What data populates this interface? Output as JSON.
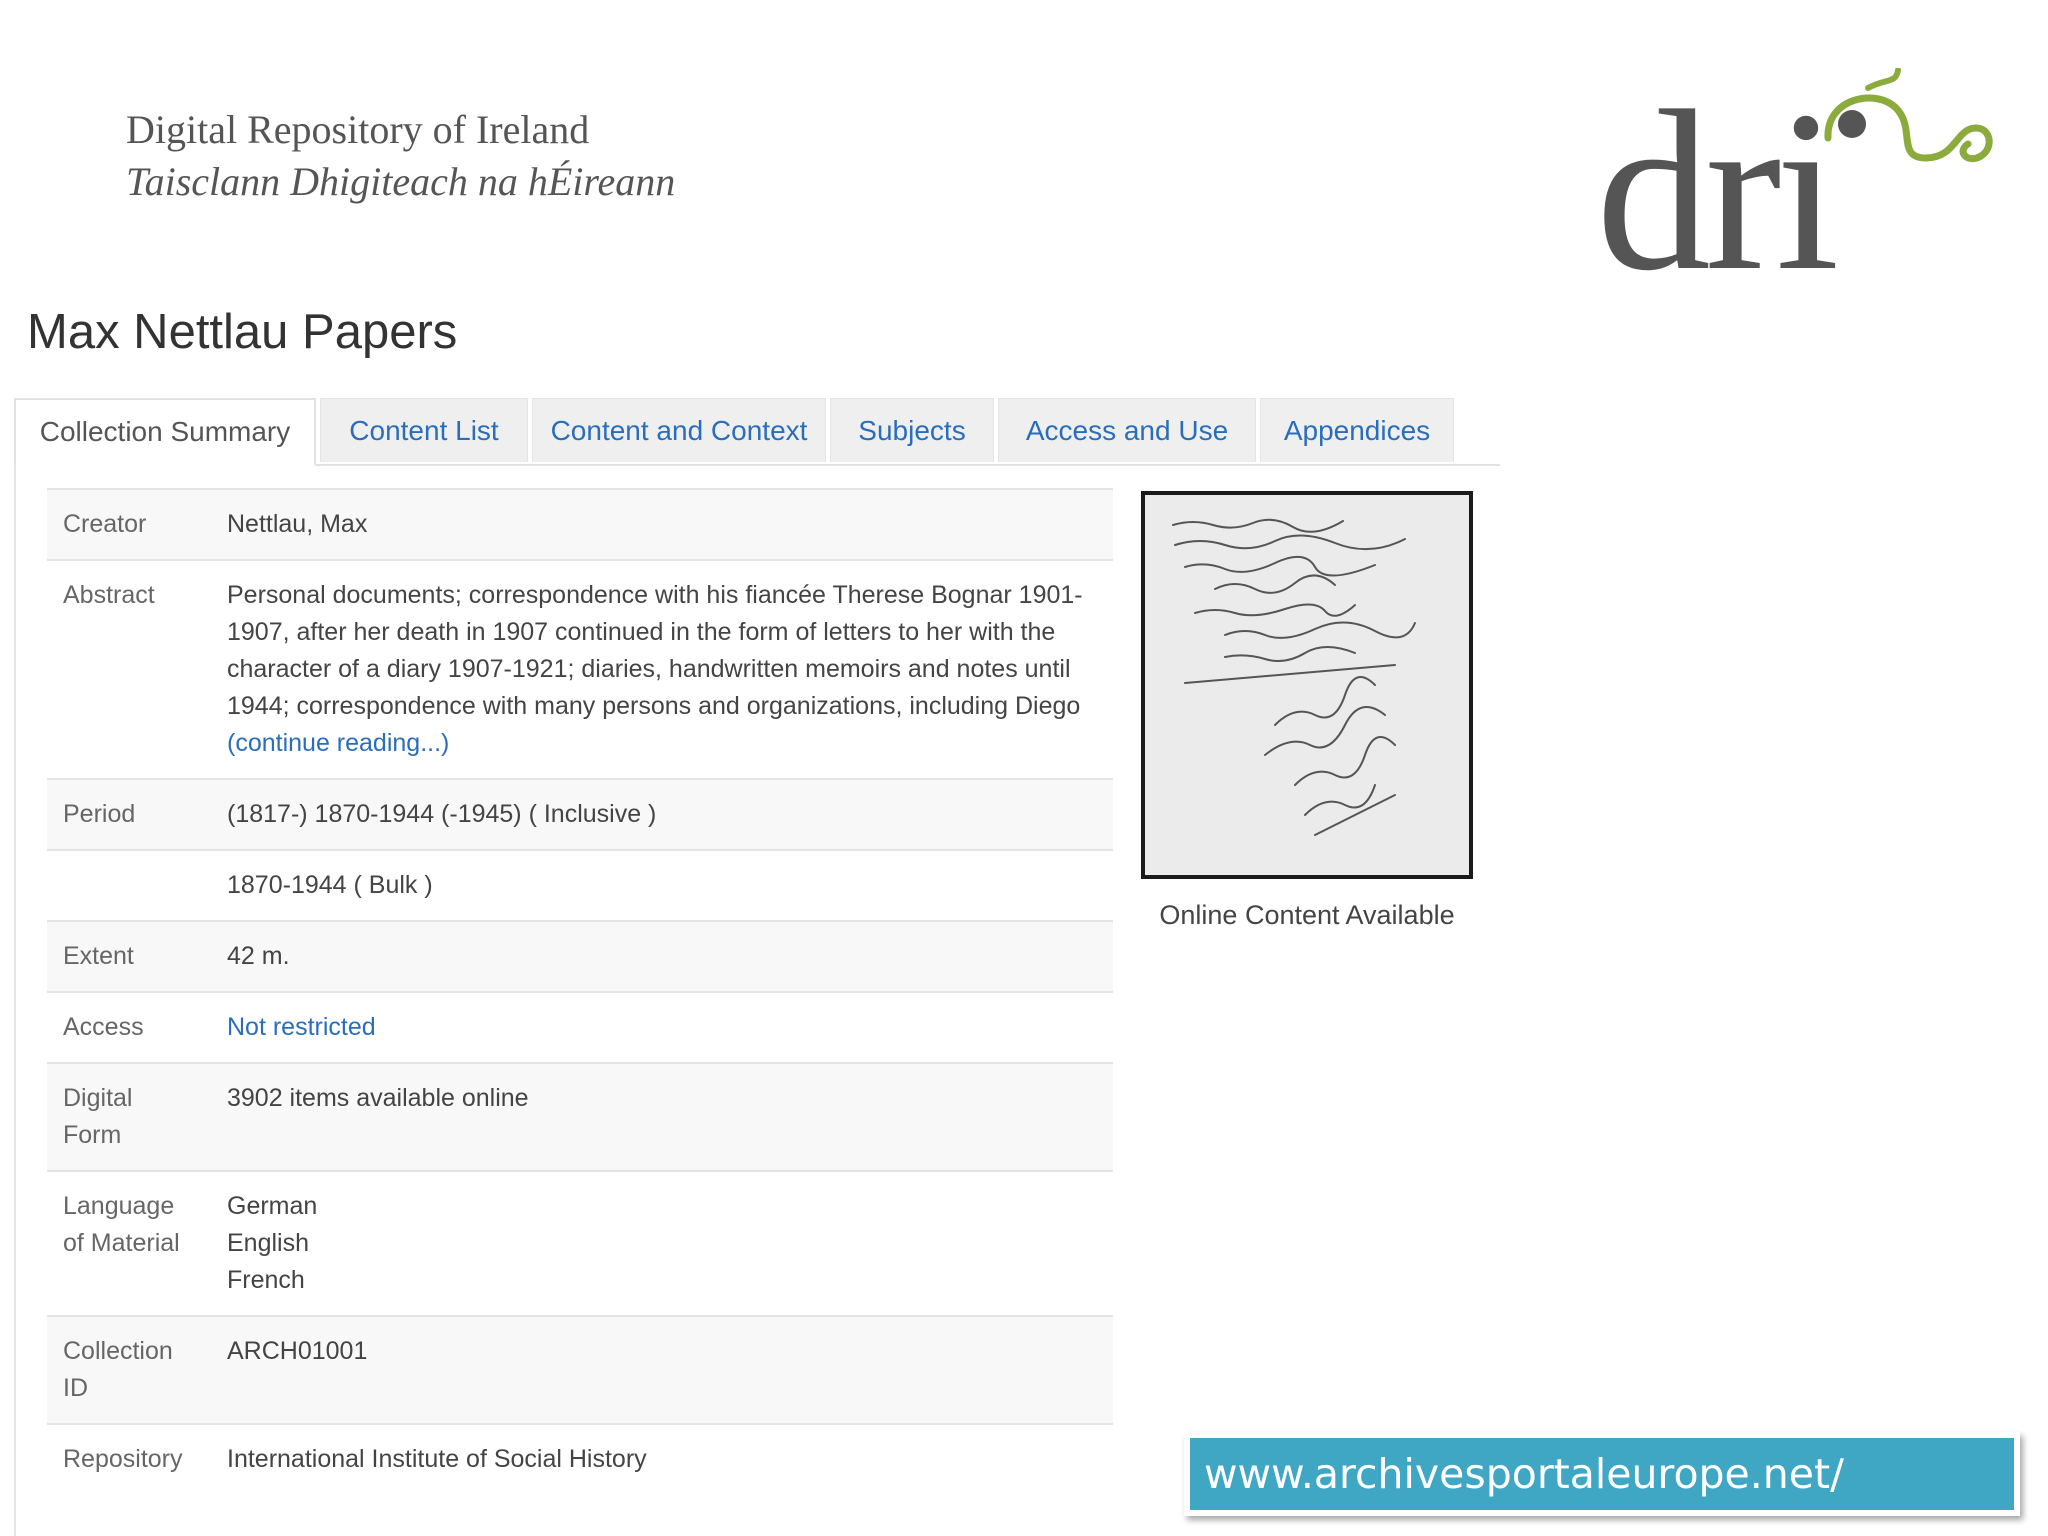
{
  "header": {
    "org_name_en": "Digital Repository of Ireland",
    "org_name_ga": "Taisclann Dhigiteach na hÉireann",
    "logo_text": "dri",
    "logo_icon": "dri-swirl-logo-icon"
  },
  "page_title": "Max Nettlau Papers",
  "tabs": [
    {
      "label": "Collection Summary",
      "active": true
    },
    {
      "label": "Content List",
      "active": false
    },
    {
      "label": "Content and Context",
      "active": false
    },
    {
      "label": "Subjects",
      "active": false
    },
    {
      "label": "Access and Use",
      "active": false
    },
    {
      "label": "Appendices",
      "active": false
    }
  ],
  "summary": {
    "creator": {
      "label": "Creator",
      "value": "Nettlau, Max"
    },
    "abstract": {
      "label": "Abstract",
      "value": "Personal documents; correspondence with his fiancée Therese Bognar 1901-1907, after her death in 1907 continued in the form of letters to her with the character of a diary 1907-1921; diaries, handwritten memoirs and notes until 1944; correspondence with many persons and organizations, including Diego",
      "more_link": "(continue reading...)"
    },
    "period": {
      "label": "Period",
      "value_inclusive": "(1817-) 1870-1944 (-1945) ( Inclusive )",
      "value_bulk": "1870-1944 ( Bulk )"
    },
    "extent": {
      "label": "Extent",
      "value": "42 m."
    },
    "access": {
      "label": "Access",
      "value": "Not restricted"
    },
    "digital_form": {
      "label_line1": "Digital",
      "label_line2": "Form",
      "value": "3902 items available online"
    },
    "language": {
      "label_line1": "Language",
      "label_line2": "of Material",
      "values": [
        "German",
        "English",
        "French"
      ]
    },
    "collection_id": {
      "label_line1": "Collection",
      "label_line2": "ID",
      "value": "ARCH01001"
    },
    "repository": {
      "label": "Repository",
      "value": "International Institute of Social History"
    }
  },
  "thumbnail": {
    "caption": "Online Content Available"
  },
  "url_banner": "www.archivesportaleurope.net/",
  "colors": {
    "link": "#2a6ebb",
    "banner": "#3fa7c4",
    "logo_dark": "#555555",
    "logo_green": "#8bab3c"
  }
}
